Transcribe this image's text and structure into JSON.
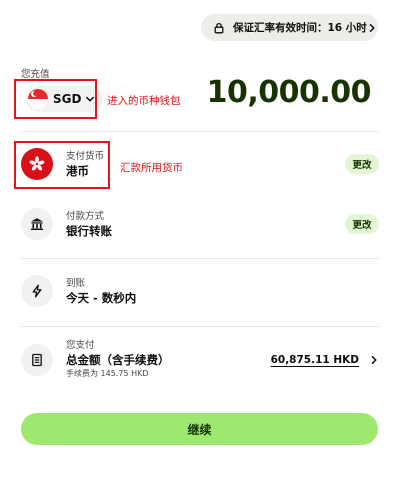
{
  "rate_guarantee": {
    "text": "保证汇率有效时间：16 小时"
  },
  "send": {
    "label": "您充值",
    "currency_code": "SGD",
    "amount": "10,000.00"
  },
  "annotations": {
    "wallet_note": "进入的币种钱包",
    "currency_note": "汇款所用货币"
  },
  "pay_currency": {
    "label": "支付货币",
    "value": "港币",
    "change_label": "更改"
  },
  "payment_method": {
    "label": "付款方式",
    "value": "银行转账",
    "change_label": "更改"
  },
  "arrival": {
    "label": "到账",
    "value": "今天 - 数秒内"
  },
  "you_pay": {
    "label": "您支付",
    "value": "总金额（含手续费）",
    "fee_note": "手续费为 145.75 HKD",
    "total": "60,875.11 HKD"
  },
  "continue_label": "继续",
  "colors": {
    "accent": "#9fe870",
    "accent_text": "#163300",
    "annotation_red": "#e4141e",
    "change_bg": "#e2f6d5"
  },
  "icons": {
    "lock": "lock-icon",
    "bank": "bank-icon",
    "lightning": "lightning-icon",
    "receipt": "receipt-icon",
    "hk_flag": "hk-flag-icon",
    "sg_flag": "sg-flag-icon"
  }
}
